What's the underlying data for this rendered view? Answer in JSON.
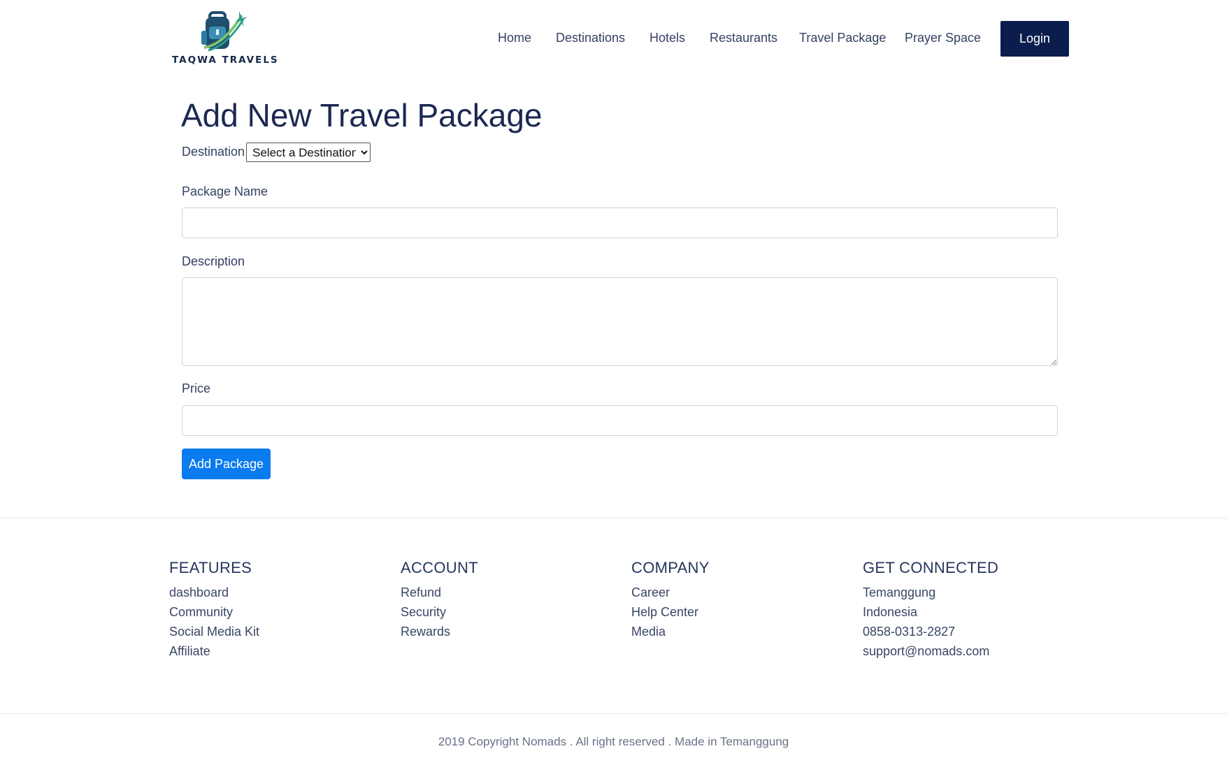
{
  "header": {
    "brand": "TAQWA TRAVELS",
    "logo_icon": "backpack-plane-icon",
    "nav": [
      {
        "label": "Home"
      },
      {
        "label": "Destinations"
      },
      {
        "label": "Hotels"
      },
      {
        "label": "Restaurants"
      },
      {
        "label": "Travel Package"
      },
      {
        "label": "Prayer Space"
      }
    ],
    "login_label": "Login"
  },
  "form": {
    "title": "Add New Travel Package",
    "destination_label": "Destination",
    "destination_selected": "Select a Destination",
    "package_name_label": "Package Name",
    "package_name_value": "",
    "description_label": "Description",
    "description_value": "",
    "price_label": "Price",
    "price_value": "",
    "submit_label": "Add Package"
  },
  "footer": {
    "columns": [
      {
        "heading": "FEATURES",
        "items": [
          "dashboard",
          "Community",
          "Social Media Kit",
          "Affiliate"
        ]
      },
      {
        "heading": "ACCOUNT",
        "items": [
          "Refund",
          "Security",
          "Rewards"
        ]
      },
      {
        "heading": "COMPANY",
        "items": [
          "Career",
          "Help Center",
          "Media"
        ]
      },
      {
        "heading": "GET CONNECTED",
        "items": [
          "Temanggung",
          "Indonesia",
          "0858-0313-2827",
          "support@nomads.com"
        ]
      }
    ],
    "copyright": "2019 Copyright Nomads . All right reserved . Made in Temanggung"
  },
  "colors": {
    "primary_navy": "#0b1d4d",
    "button_blue": "#0b7bf0",
    "logo_teal": "#2a9d8f"
  }
}
